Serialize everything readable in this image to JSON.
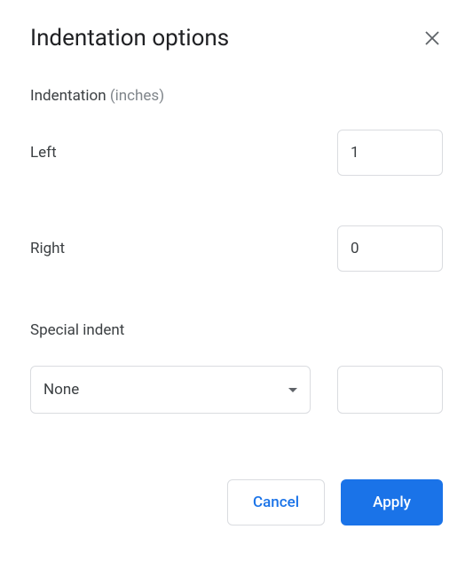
{
  "dialog": {
    "title": "Indentation options",
    "section_label": "Indentation",
    "section_unit": "(inches)",
    "left_label": "Left",
    "left_value": "1",
    "right_label": "Right",
    "right_value": "0",
    "special_label": "Special indent",
    "special_selected": "None",
    "special_value": "",
    "cancel_label": "Cancel",
    "apply_label": "Apply"
  }
}
